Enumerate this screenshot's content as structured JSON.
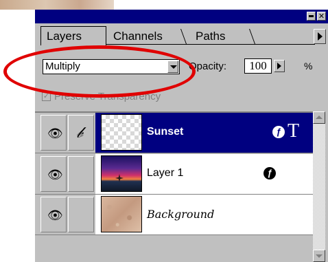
{
  "tabs": [
    {
      "label": "Layers",
      "active": true
    },
    {
      "label": "Channels",
      "active": false
    },
    {
      "label": "Paths",
      "active": false
    }
  ],
  "blend_mode": {
    "selected": "Multiply"
  },
  "opacity": {
    "label": "Opacity:",
    "value": "100",
    "unit": "%"
  },
  "preserve_transparency": {
    "label": "Preserve Transparency",
    "checked": true,
    "enabled": false
  },
  "layers": [
    {
      "name": "Sunset",
      "selected": true,
      "has_effects": true,
      "is_text": true,
      "visible": true,
      "brush": true,
      "fx_icon": "effects-icon",
      "type_icon": "T"
    },
    {
      "name": "Layer 1",
      "selected": false,
      "has_effects": true,
      "is_text": false,
      "visible": true,
      "brush": false,
      "fx_icon": "effects-icon"
    },
    {
      "name": "Background",
      "selected": false,
      "has_effects": false,
      "is_text": false,
      "visible": true,
      "brush": false
    }
  ],
  "icons": {
    "eye": "👁",
    "brush": "𝒷",
    "fx": "ƒ",
    "t": "T"
  },
  "colors": {
    "titlebar": "#000080",
    "panel": "#c0c0c0",
    "selection": "#000080",
    "highlight_ellipse": "#e00000"
  }
}
